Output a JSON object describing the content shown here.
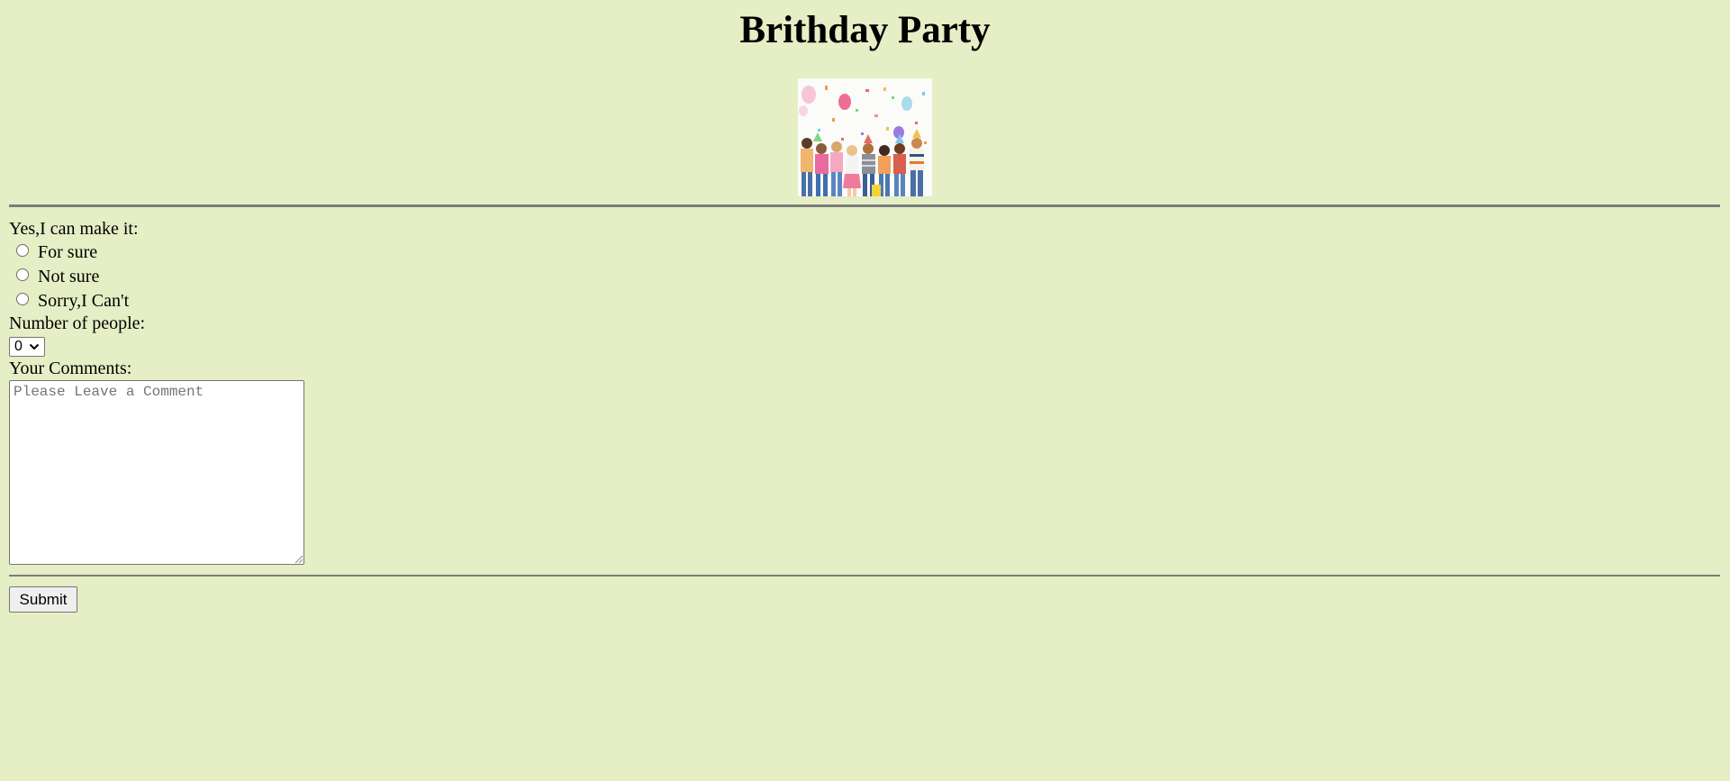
{
  "page": {
    "title": "Brithday Party",
    "background": "#e5eec4"
  },
  "image": {
    "alt": "Children celebrating at a birthday party with balloons and confetti",
    "icon": "party-photo"
  },
  "form": {
    "attendance_label": "Yes,I can make it:",
    "options": [
      {
        "label": "For sure",
        "checked": false
      },
      {
        "label": "Not sure",
        "checked": false
      },
      {
        "label": "Sorry,I Can't",
        "checked": false
      }
    ],
    "people_label": "Number of people:",
    "people_selected": "0",
    "comments_label": "Your Comments:",
    "comments_placeholder": "Please Leave a Comment",
    "comments_value": "",
    "submit_label": "Submit"
  }
}
